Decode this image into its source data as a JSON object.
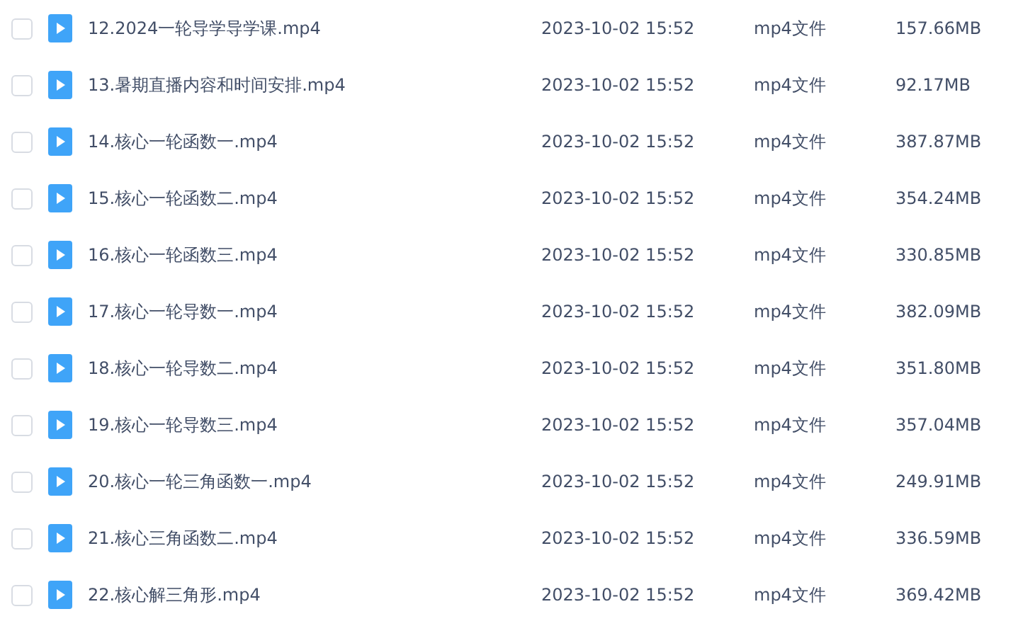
{
  "files": [
    {
      "checked": false,
      "name": "12.2024一轮导学导学课.mp4",
      "modified": "2023-10-02 15:52",
      "type": "mp4文件",
      "size": "157.66MB"
    },
    {
      "checked": false,
      "name": "13.暑期直播内容和时间安排.mp4",
      "modified": "2023-10-02 15:52",
      "type": "mp4文件",
      "size": "92.17MB"
    },
    {
      "checked": false,
      "name": "14.核心一轮函数一.mp4",
      "modified": "2023-10-02 15:52",
      "type": "mp4文件",
      "size": "387.87MB"
    },
    {
      "checked": false,
      "name": "15.核心一轮函数二.mp4",
      "modified": "2023-10-02 15:52",
      "type": "mp4文件",
      "size": "354.24MB"
    },
    {
      "checked": false,
      "name": "16.核心一轮函数三.mp4",
      "modified": "2023-10-02 15:52",
      "type": "mp4文件",
      "size": "330.85MB"
    },
    {
      "checked": false,
      "name": "17.核心一轮导数一.mp4",
      "modified": "2023-10-02 15:52",
      "type": "mp4文件",
      "size": "382.09MB"
    },
    {
      "checked": false,
      "name": "18.核心一轮导数二.mp4",
      "modified": "2023-10-02 15:52",
      "type": "mp4文件",
      "size": "351.80MB"
    },
    {
      "checked": false,
      "name": "19.核心一轮导数三.mp4",
      "modified": "2023-10-02 15:52",
      "type": "mp4文件",
      "size": "357.04MB"
    },
    {
      "checked": false,
      "name": "20.核心一轮三角函数一.mp4",
      "modified": "2023-10-02 15:52",
      "type": "mp4文件",
      "size": "249.91MB"
    },
    {
      "checked": false,
      "name": "21.核心三角函数二.mp4",
      "modified": "2023-10-02 15:52",
      "type": "mp4文件",
      "size": "336.59MB"
    },
    {
      "checked": false,
      "name": "22.核心解三角形.mp4",
      "modified": "2023-10-02 15:52",
      "type": "mp4文件",
      "size": "369.42MB"
    }
  ]
}
